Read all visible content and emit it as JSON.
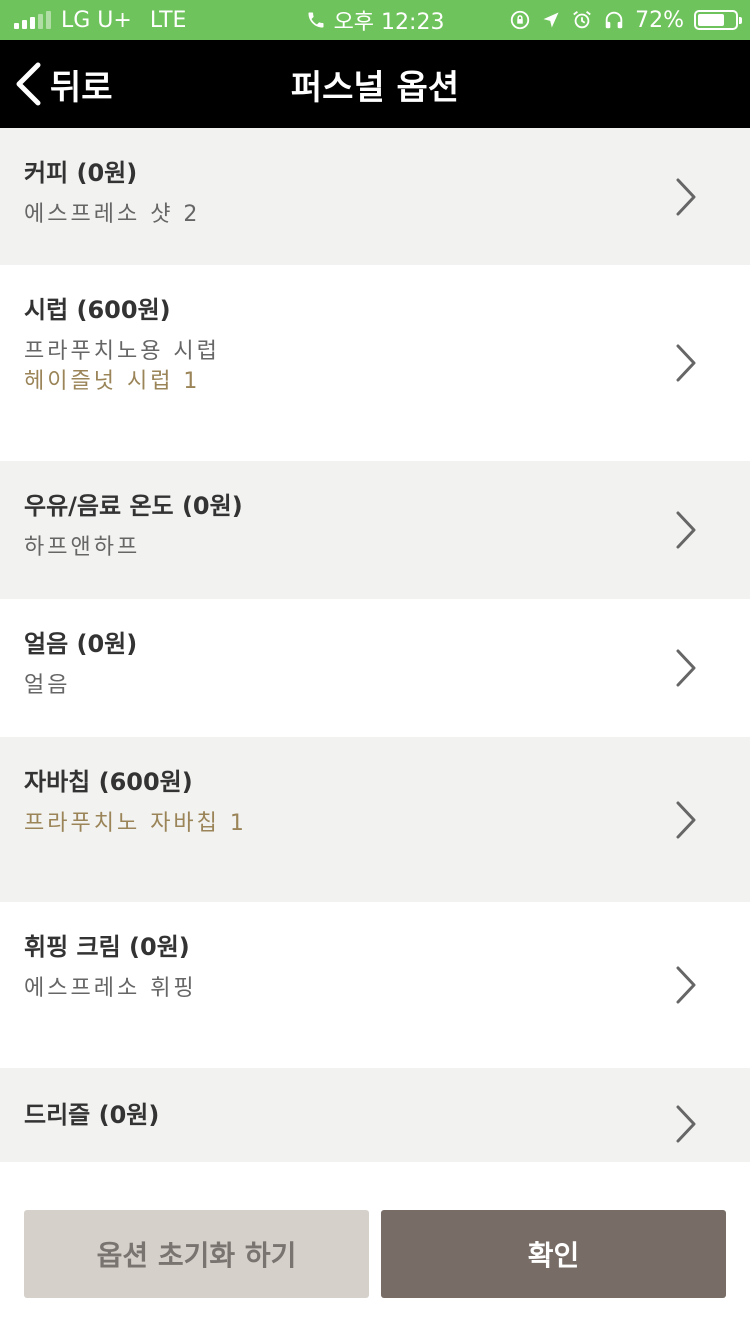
{
  "status_bar": {
    "carrier": "LG U+",
    "network": "LTE",
    "time": "오후 12:23",
    "battery_percent": "72%",
    "battery_level": 0.72,
    "signal_bars_filled": 3,
    "signal_bars_total": 5,
    "icons": [
      "phone-icon",
      "lock-rotation-icon",
      "location-icon",
      "alarm-icon",
      "headphones-icon",
      "battery-icon"
    ]
  },
  "nav": {
    "back_label": "뒤로",
    "title": "퍼스널 옵션",
    "back_icon": "chevron-left-icon"
  },
  "options": [
    {
      "title": "커피 (0원)",
      "sub": "에스프레소 샷 2",
      "sub2": ""
    },
    {
      "title": "시럽 (600원)",
      "sub": "프라푸치노용 시럽",
      "sub2": "헤이즐넛 시럽 1"
    },
    {
      "title": "우유/음료 온도 (0원)",
      "sub": "하프앤하프",
      "sub2": ""
    },
    {
      "title": "얼음 (0원)",
      "sub": "얼음",
      "sub2": ""
    },
    {
      "title": "자바칩 (600원)",
      "sub": "프라푸치노 자바칩 1",
      "sub2": ""
    },
    {
      "title": "휘핑 크림 (0원)",
      "sub": "에스프레소 휘핑",
      "sub2": ""
    },
    {
      "title": "드리즐 (0원)",
      "sub": "",
      "sub2": ""
    }
  ],
  "buttons": {
    "reset_label": "옵션 초기화 하기",
    "confirm_label": "확인"
  },
  "colors": {
    "status_bar": "#6fc35c",
    "nav_bar": "#000000",
    "shaded_row": "#f2f2f0",
    "selected_text": "#9a8458",
    "reset_button": "#d5d1ca",
    "confirm_button": "#776c66"
  }
}
